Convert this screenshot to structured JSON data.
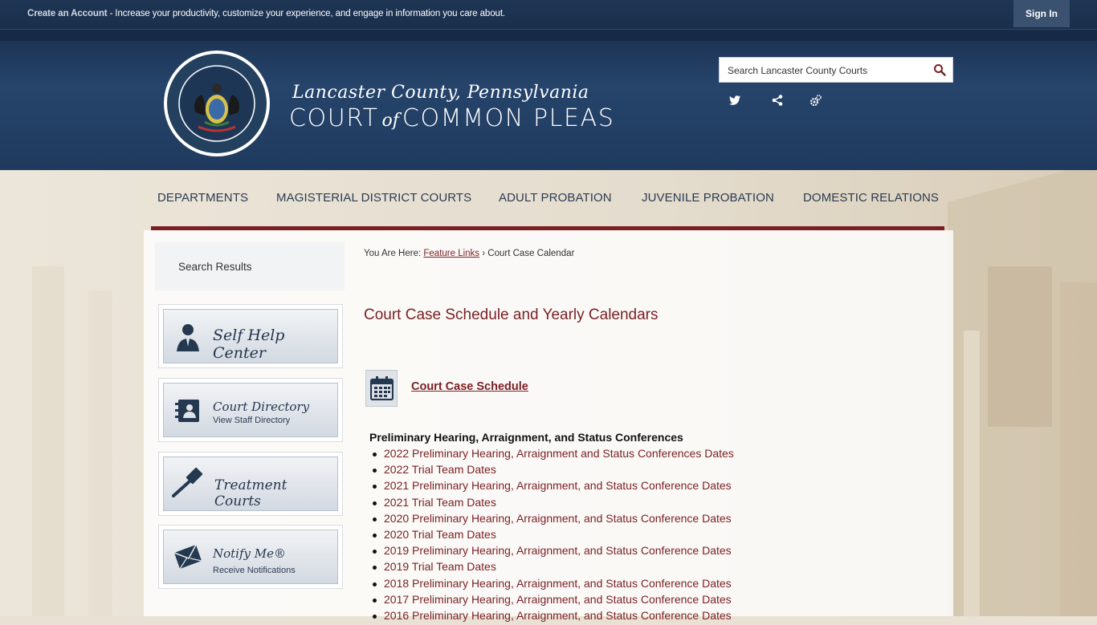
{
  "topbar": {
    "create_account": "Create an Account",
    "message": " - Increase your productivity, customize your experience, and engage in information you care about.",
    "sign_in": "Sign In"
  },
  "header": {
    "title_top": "Lancaster County, Pennsylvania",
    "title_main_left": "COURT",
    "title_main_of": "of",
    "title_main_right": "COMMON PLEAS",
    "search_placeholder": "Search Lancaster County Courts",
    "social_icons": [
      "twitter-icon",
      "share-icon",
      "settings-icon"
    ]
  },
  "nav": {
    "items": [
      "DEPARTMENTS",
      "MAGISTERIAL DISTRICT COURTS",
      "ADULT PROBATION",
      "JUVENILE PROBATION",
      "DOMESTIC RELATIONS"
    ]
  },
  "sidebar": {
    "search_results": "Search Results",
    "quick_links": [
      {
        "title": "Self Help Center",
        "subtitle": "",
        "icon": "person-icon"
      },
      {
        "title": "Court Directory",
        "subtitle": "View Staff Directory",
        "icon": "directory-icon"
      },
      {
        "title": "Treatment Courts",
        "subtitle": "",
        "icon": "gavel-icon"
      },
      {
        "title": "Notify Me®",
        "subtitle": "Receive Notifications",
        "icon": "envelope-icon"
      }
    ]
  },
  "main": {
    "breadcrumb_prefix": "You Are Here: ",
    "breadcrumb_link": "Feature Links",
    "breadcrumb_sep": " › ",
    "breadcrumb_current": "Court Case Calendar",
    "page_title": "Court Case Schedule and Yearly Calendars",
    "schedule_link": "Court Case Schedule",
    "section_title": "Preliminary Hearing, Arraignment, and Status Conferences",
    "links": [
      "2022 Preliminary Hearing, Arraignment and Status Conferences Dates",
      "2022 Trial Team Dates",
      "2021 Preliminary Hearing, Arraignment, and Status Conference Dates",
      "2021 Trial Team Dates",
      "2020 Preliminary Hearing, Arraignment, and Status Conference Dates",
      "2020 Trial Team Dates",
      "2019 Preliminary Hearing, Arraignment, and Status Conference Dates",
      "2019 Trial Team Dates",
      "2018 Preliminary Hearing, Arraignment, and Status Conference Dates",
      "2017 Preliminary Hearing, Arraignment, and Status Conference Dates",
      "2016 Preliminary Hearing, Arraignment, and Status Conference Dates"
    ]
  },
  "colors": {
    "brand_navy": "#1f3a5e",
    "accent_maroon": "#7a1f24"
  }
}
